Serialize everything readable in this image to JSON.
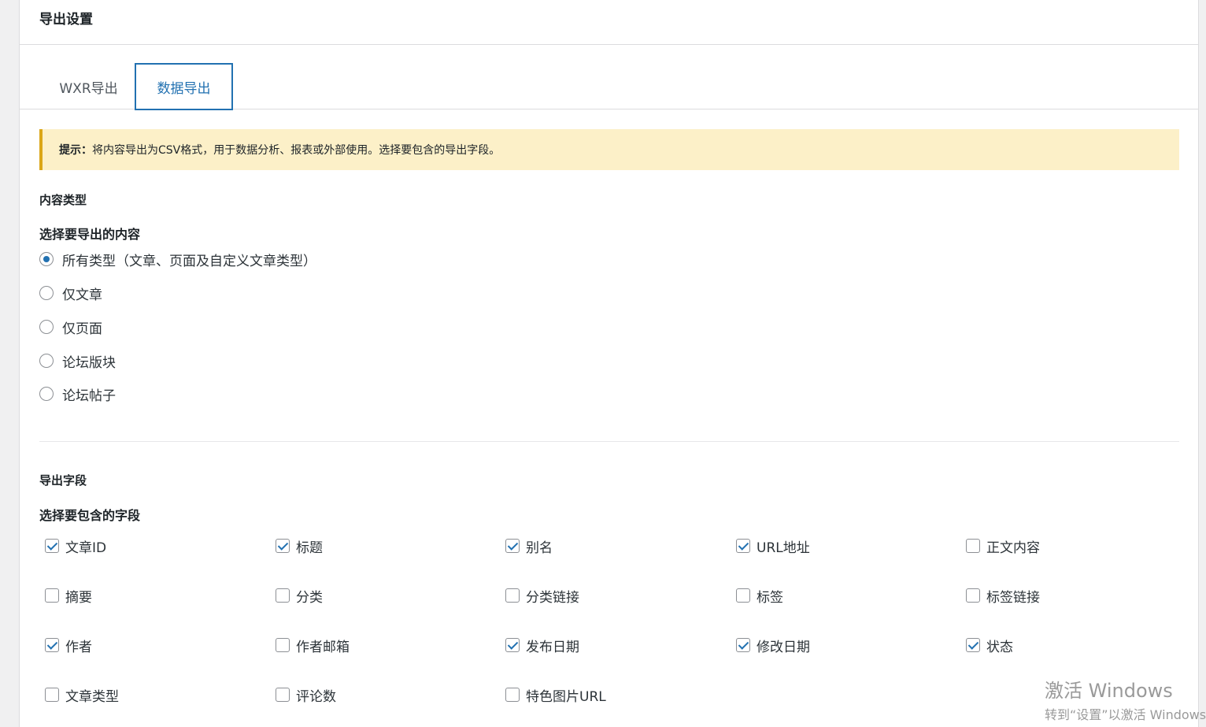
{
  "header": {
    "title": "导出设置"
  },
  "tabs": [
    {
      "label": "WXR导出",
      "active": false
    },
    {
      "label": "数据导出",
      "active": true
    }
  ],
  "notice": {
    "prefix": "提示：",
    "text": "将内容导出为CSV格式，用于数据分析、报表或外部使用。选择要包含的导出字段。"
  },
  "content_type": {
    "section_title": "内容类型",
    "prompt": "选择要导出的内容",
    "options": [
      {
        "label": "所有类型（文章、页面及自定义文章类型）",
        "selected": true
      },
      {
        "label": "仅文章",
        "selected": false
      },
      {
        "label": "仅页面",
        "selected": false
      },
      {
        "label": "论坛版块",
        "selected": false
      },
      {
        "label": "论坛帖子",
        "selected": false
      }
    ]
  },
  "fields": {
    "section_title": "导出字段",
    "prompt": "选择要包含的字段",
    "items": [
      {
        "label": "文章ID",
        "checked": true
      },
      {
        "label": "标题",
        "checked": true
      },
      {
        "label": "别名",
        "checked": true
      },
      {
        "label": "URL地址",
        "checked": true
      },
      {
        "label": "正文内容",
        "checked": false
      },
      {
        "label": "摘要",
        "checked": false
      },
      {
        "label": "分类",
        "checked": false
      },
      {
        "label": "分类链接",
        "checked": false
      },
      {
        "label": "标签",
        "checked": false
      },
      {
        "label": "标签链接",
        "checked": false
      },
      {
        "label": "作者",
        "checked": true
      },
      {
        "label": "作者邮箱",
        "checked": false
      },
      {
        "label": "发布日期",
        "checked": true
      },
      {
        "label": "修改日期",
        "checked": true
      },
      {
        "label": "状态",
        "checked": true
      },
      {
        "label": "文章类型",
        "checked": false
      },
      {
        "label": "评论数",
        "checked": false
      },
      {
        "label": "特色图片URL",
        "checked": false
      }
    ]
  },
  "watermark": {
    "line1": "激活 Windows",
    "line2": "转到“设置”以激活 Windows。"
  },
  "colors": {
    "accent": "#2271b1",
    "notice_bg": "#fcf0c8",
    "notice_border": "#dba617"
  }
}
